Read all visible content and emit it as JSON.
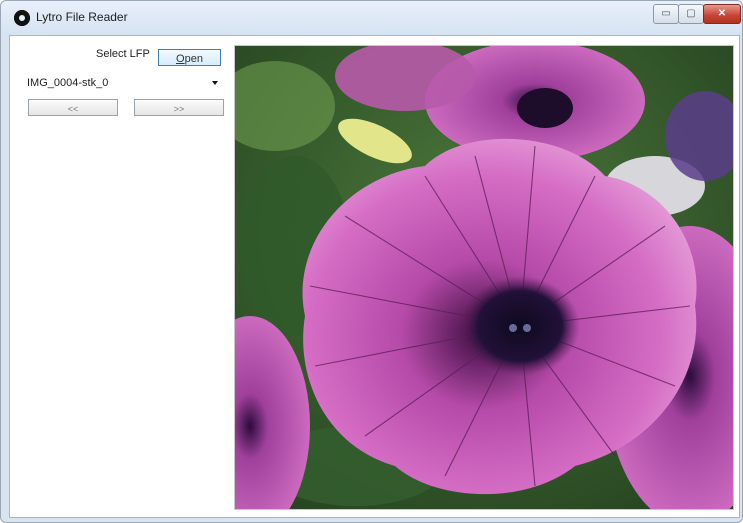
{
  "window": {
    "title": "Lytro File Reader",
    "minimize": "▭",
    "maximize": "▢",
    "close": "✕"
  },
  "controls": {
    "select_label": "Select LFP",
    "open_label_accel": "O",
    "open_label_rest": "pen",
    "file_value": "IMG_0004-stk_0",
    "prev_label": "<<",
    "next_label": ">>"
  },
  "image": {
    "subject": "purple petunia flower close-up",
    "colors": {
      "petal": "#c44fb0",
      "center": "#1e0f33",
      "leaves": "#3e6b34"
    }
  }
}
